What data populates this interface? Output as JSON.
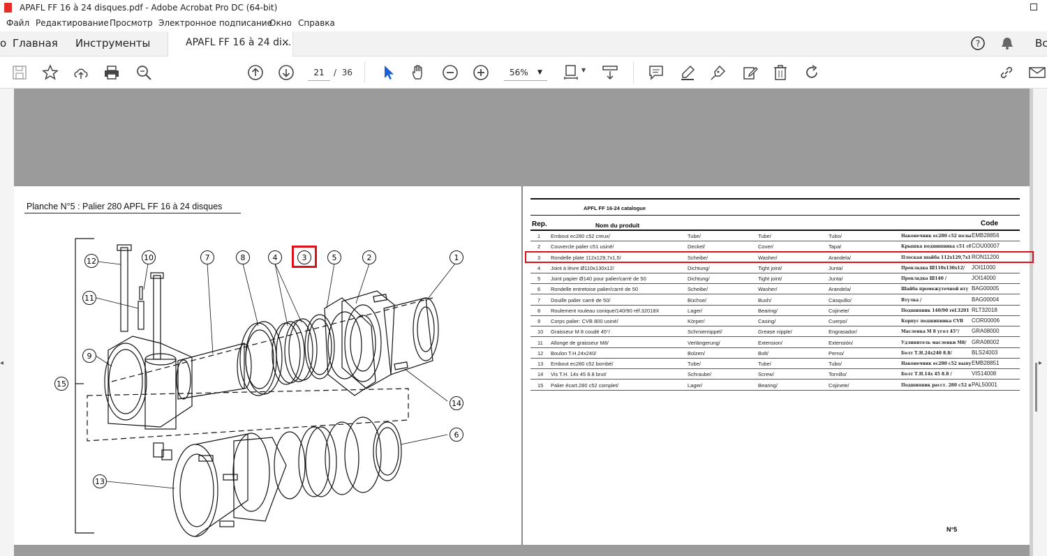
{
  "window": {
    "title": "APAFL FF 16 à 24 disques.pdf - Adobe Acrobat Pro DC (64-bit)"
  },
  "menu": [
    "Файл",
    "Редактирование",
    "Просмотр",
    "Электронное подписание",
    "Окно",
    "Справка"
  ],
  "tabs": {
    "partial_left": "о",
    "home": "Главная",
    "tools": "Инструменты",
    "document": "APAFL FF 16 à 24 di...",
    "close": "×",
    "right_cut": "Вс"
  },
  "toolbar": {
    "page_current": "21",
    "page_separator": "/",
    "page_total": "36",
    "zoom": "56%"
  },
  "drawing": {
    "title": "Planche N°5 : Palier 280 APFL FF 16 à 24 disques",
    "callouts": [
      "1",
      "2",
      "3",
      "4",
      "5",
      "6",
      "7",
      "8",
      "9",
      "10",
      "11",
      "12",
      "13",
      "14",
      "15"
    ]
  },
  "table": {
    "title": "APFL FF 16-24 catalogue",
    "headers": {
      "rep": "Rep.",
      "name": "Nom du produit",
      "code": "Code"
    },
    "rows": [
      {
        "rep": "1",
        "fr": "Embout ec280 c52 creux/",
        "de": "Tube/",
        "en": "Tube/",
        "es": "Tubo/",
        "ru": "Наконечник ec280 c52 полы",
        "code": "EMB28856"
      },
      {
        "rep": "2",
        "fr": "Couvercle palier c51 usiné/",
        "de": "Deckel/",
        "en": "Cover/",
        "es": "Tapa/",
        "ru": "Крышка подшипника c51 сбор",
        "code": "COU00007"
      },
      {
        "rep": "3",
        "fr": "Rondelle plate  112x129,7x1,5/",
        "de": "Scheibe/",
        "en": "Washer/",
        "es": "Arandela/",
        "ru": "Плоская шайба 112x129,7x1",
        "code": "RON11200"
      },
      {
        "rep": "4",
        "fr": "Joint à lèvre Ø110x130x12/",
        "de": "Dichtung/",
        "en": "Tight joint/",
        "es": "Junta/",
        "ru": "Прокладка Ш110x130x12/",
        "code": "JOI11000"
      },
      {
        "rep": "5",
        "fr": "Joint papier Ø140 pour palier/carré de 50",
        "de": "Dichtung/",
        "en": "Tight joint/",
        "es": "Junta/",
        "ru": "Прокладка Ш140 /",
        "code": "JOI14000"
      },
      {
        "rep": "6",
        "fr": "Rondelle entretoise palier/carré de 50",
        "de": "Scheibe/",
        "en": "Washer/",
        "es": "Arandela/",
        "ru": "Шайба промежуточной вту",
        "code": "BAG00005"
      },
      {
        "rep": "7",
        "fr": "Douille palier carré de 50/",
        "de": "Büchse/",
        "en": "Bush/",
        "es": "Casquillo/",
        "ru": "Втулка /",
        "code": "BAG00004"
      },
      {
        "rep": "8",
        "fr": "Roulement rouleau conique/140/90  réf.32018X",
        "de": "Lager/",
        "en": "Bearing/",
        "es": "Cojinete/",
        "ru": "Подшипник 140/90  réf.3201",
        "code": "RLT32018"
      },
      {
        "rep": "9",
        "fr": "Corps palier: CVB 800 usiné/",
        "de": "Körper/",
        "en": "Casing/",
        "es": "Cuerpo/",
        "ru": "Корпус подшипника CVB",
        "code": "COR00006"
      },
      {
        "rep": "10",
        "fr": "Graisseur M  8 coudé 45°/",
        "de": "Schmiernippel/",
        "en": "Grease nipple/",
        "es": "Engrasador/",
        "ru": "Масленка М  8 угол 45°/",
        "code": "GRA08000"
      },
      {
        "rep": "11",
        "fr": "Allonge de graisseur M8/",
        "de": "Verlängerung/",
        "en": "Extension/",
        "es": "Extensión/",
        "ru": "Удлинитель масленки М8/",
        "code": "GRA08002"
      },
      {
        "rep": "12",
        "fr": "Boulon T.H.24x240/",
        "de": "Bolzen/",
        "en": "Bolt/",
        "es": "Perno/",
        "ru": "Болт Т.Н.24x240 8.8/",
        "code": "BLS24003"
      },
      {
        "rep": "13",
        "fr": "Embout ec280 c52 bombé/",
        "de": "Tube/",
        "en": "Tube/",
        "es": "Tubo/",
        "ru": "Наконечник ec280 c52 выпу",
        "code": "EMB28851"
      },
      {
        "rep": "14",
        "fr": "Vis T.H. 14x 45 8.8 brut/",
        "de": "Schraube/",
        "en": "Screw/",
        "es": "Tornillo/",
        "ru": "Болт Т.Н.14x 45 8.8 /",
        "code": "VIS14008"
      },
      {
        "rep": "15",
        "fr": "Palier écart.280 c52 complet/",
        "de": "Lager/",
        "en": "Bearing/",
        "es": "Cojinete/",
        "ru": "Подшипник расст. 280 c52 в",
        "code": "PAL50001"
      }
    ],
    "page_label": "N°5"
  },
  "colors": {
    "highlight": "#e0101a",
    "acrobat_red": "#e32d25",
    "select_blue": "#1a5fd6"
  }
}
